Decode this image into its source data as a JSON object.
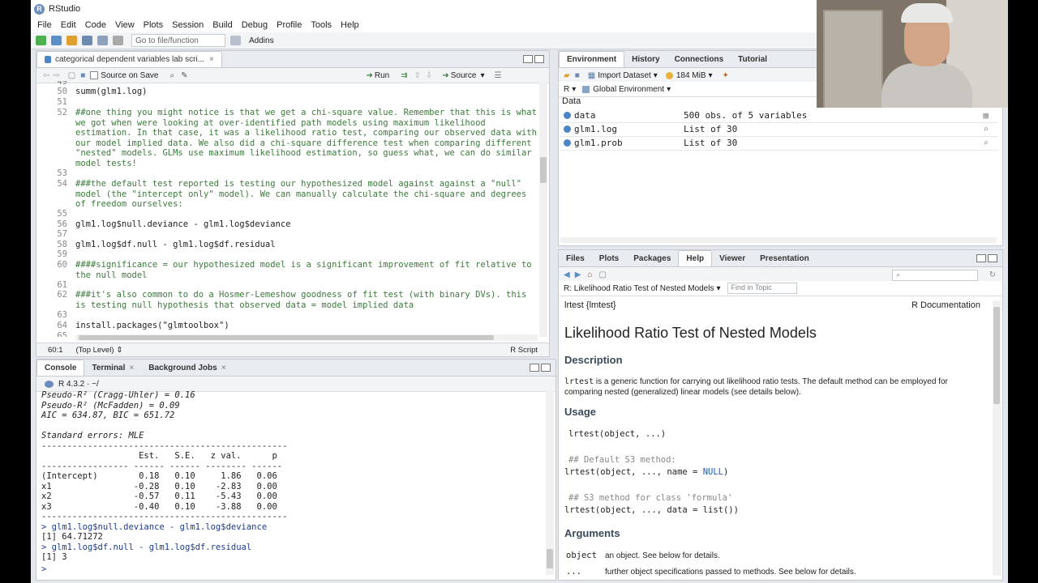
{
  "window": {
    "title": "RStudio"
  },
  "menu": [
    "File",
    "Edit",
    "Code",
    "View",
    "Plots",
    "Session",
    "Build",
    "Debug",
    "Profile",
    "Tools",
    "Help"
  ],
  "toolbar": {
    "goto_placeholder": "Go to file/function",
    "addins": "Addins"
  },
  "editor": {
    "tab_label": "categorical dependent variables lab scri...",
    "source_on_save": "Source on Save",
    "run": "Run",
    "source": "Source",
    "first_line_number": "49",
    "lines": [
      {
        "n": "50",
        "text": "summ(glm1.log)",
        "comment": false
      },
      {
        "n": "51",
        "text": "",
        "comment": false
      },
      {
        "n": "52",
        "text": "##one thing you might notice is that we get a chi-square value. Remember that this is what we got when were looking at over-identified path models using maximum likelihood estimation. In that case, it was a likelihood ratio test, comparing our observed data with our model implied data. We also did a chi-square difference test when comparing different \"nested\" models. GLMs use maximum likelihood estimation, so guess what, we can do similar model tests!",
        "comment": true
      },
      {
        "n": "53",
        "text": "",
        "comment": false
      },
      {
        "n": "54",
        "text": "###the default test reported is testing our hypothesized model against against a \"null\" model (the \"intercept only\" model). We can manually calculate the chi-square and degrees of freedom ourselves:",
        "comment": true
      },
      {
        "n": "55",
        "text": "",
        "comment": false
      },
      {
        "n": "56",
        "text": "glm1.log$null.deviance - glm1.log$deviance",
        "comment": false
      },
      {
        "n": "57",
        "text": "",
        "comment": false
      },
      {
        "n": "58",
        "text": "glm1.log$df.null - glm1.log$df.residual",
        "comment": false
      },
      {
        "n": "59",
        "text": "",
        "comment": false
      },
      {
        "n": "60",
        "text": "####significance = our hypothesized model is a significant improvement of fit relative to the null model",
        "comment": true
      },
      {
        "n": "61",
        "text": "",
        "comment": false
      },
      {
        "n": "62",
        "text": "###it's also common to do a Hosmer-Lemeshow goodness of fit test (with binary DVs). this is testing null hypothesis that observed data = model implied data",
        "comment": true
      },
      {
        "n": "63",
        "text": "",
        "comment": false
      },
      {
        "n": "64",
        "text": "install.packages(\"glmtoolbox\")",
        "comment": false
      },
      {
        "n": "65",
        "text": "",
        "comment": false
      }
    ],
    "status_pos": "60:1",
    "status_scope": "(Top Level)",
    "status_type": "R Script"
  },
  "console": {
    "tabs": [
      "Console",
      "Terminal",
      "Background Jobs"
    ],
    "r_version": "R 4.3.2 · ~/",
    "output": [
      "Pseudo-R² (Cragg-Uhler) = 0.16",
      "Pseudo-R² (McFadden) = 0.09",
      "AIC = 634.87, BIC = 651.72",
      "",
      "Standard errors: MLE",
      "------------------------------------------------",
      "                   Est.   S.E.   z val.      p",
      "----------------- ------ ------ -------- ------",
      "(Intercept)        0.18   0.10     1.86   0.06",
      "x1                -0.28   0.10    -2.83   0.00",
      "x2                -0.57   0.11    -5.43   0.00",
      "x3                -0.40   0.10    -3.88   0.00",
      "------------------------------------------------",
      "",
      "> glm1.log$null.deviance - glm1.log$deviance",
      "[1] 64.71272",
      "> glm1.log$df.null - glm1.log$df.residual",
      "[1] 3",
      "> "
    ]
  },
  "environment": {
    "tabs": [
      "Environment",
      "History",
      "Connections",
      "Tutorial"
    ],
    "import_dataset": "Import Dataset",
    "memory": "184 MiB",
    "language": "R",
    "scope": "Global Environment",
    "section": "Data",
    "rows": [
      {
        "name": "data",
        "value": "500 obs. of 5 variables"
      },
      {
        "name": "glm1.log",
        "value": "List of  30"
      },
      {
        "name": "glm1.prob",
        "value": "List of  30"
      }
    ]
  },
  "help": {
    "tabs": [
      "Files",
      "Plots",
      "Packages",
      "Help",
      "Viewer",
      "Presentation"
    ],
    "topic": "R: Likelihood Ratio Test of Nested Models",
    "find_placeholder": "Find in Topic",
    "pkg": "lrtest {lmtest}",
    "rdoc": "R Documentation",
    "title": "Likelihood Ratio Test of Nested Models",
    "desc_h": "Description",
    "desc_fn": "lrtest",
    "desc_text": " is a generic function for carrying out likelihood ratio tests. The default method can be employed for comparing nested (generalized) linear models (see details below).",
    "usage_h": "Usage",
    "usage_1": "lrtest(object, ...)",
    "usage_c1": "## Default S3 method:",
    "usage_2a": "lrtest(object, ..., name = ",
    "usage_2b": "NULL",
    "usage_2c": ")",
    "usage_c2": "## S3 method for class 'formula'",
    "usage_3": "lrtest(object, ..., data = list())",
    "args_h": "Arguments",
    "arg1_name": "object",
    "arg1_desc": "an object. See below for details.",
    "arg2_name": "...",
    "arg2_desc": "further object specifications passed to methods. See below for details."
  }
}
